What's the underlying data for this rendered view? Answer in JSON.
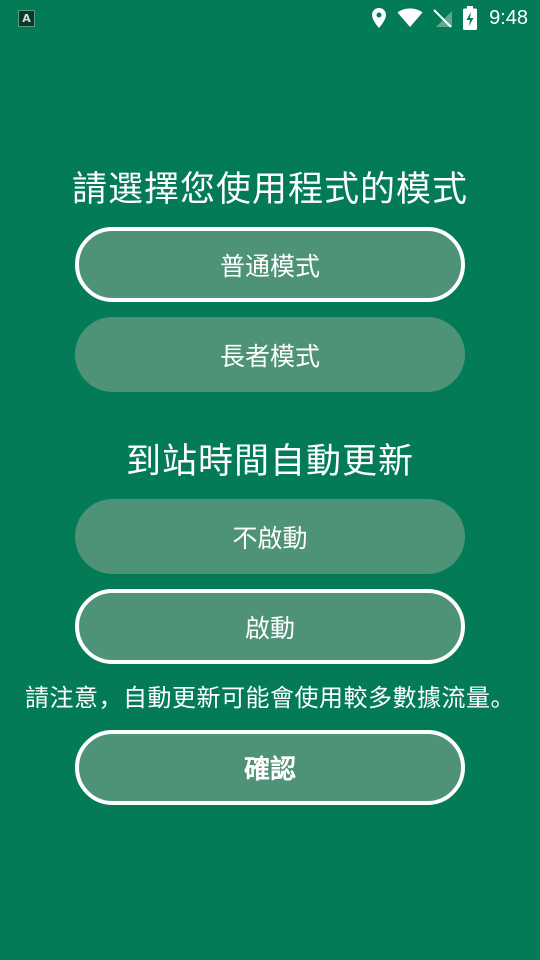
{
  "status_bar": {
    "app_icon_letter": "A",
    "time": "9:48",
    "icons": [
      "location-icon",
      "wifi-icon",
      "no-signal-icon",
      "battery-charging-icon"
    ]
  },
  "mode_section": {
    "title": "請選擇您使用程式的模式",
    "options": [
      {
        "label": "普通模式",
        "selected": true
      },
      {
        "label": "長者模式",
        "selected": false
      }
    ]
  },
  "update_section": {
    "title": "到站時間自動更新",
    "options": [
      {
        "label": "不啟動",
        "selected": false
      },
      {
        "label": "啟動",
        "selected": true
      }
    ],
    "notice": "請注意，自動更新可能會使用較多數據流量。"
  },
  "confirm_label": "確認",
  "colors": {
    "background": "#037b57",
    "button_fill": "#4e9377",
    "selected_border": "#ffffff"
  }
}
